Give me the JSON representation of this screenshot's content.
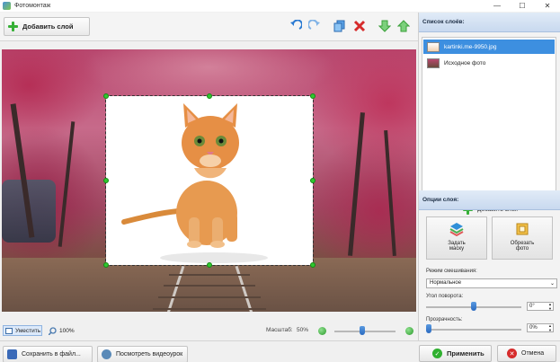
{
  "window": {
    "title": "Фотомонтаж",
    "minimize": "—",
    "maximize": "☐",
    "close": "✕"
  },
  "toolbar": {
    "add_layer_label": "Добавить слой"
  },
  "zoom": {
    "fit_label": "Уместить",
    "actual_size_label": "100%",
    "scale_label": "Масштаб:",
    "scale_value": "50%",
    "level_fraction": 0.45
  },
  "bottom": {
    "save_label": "Сохранить в файл...",
    "video_label": "Посмотреть видеоурок",
    "apply_label": "Применить",
    "cancel_label": "Отмена"
  },
  "layers_panel": {
    "header": "Список слоёв:",
    "layers": [
      {
        "name": "kartinki.me-9950.jpg",
        "selected": true
      },
      {
        "name": "Исходное фото",
        "selected": false
      }
    ],
    "add_label": "Добавить слой"
  },
  "options_panel": {
    "header": "Опции слоя:",
    "mask_label_1": "Задать",
    "mask_label_2": "маску",
    "crop_label_1": "Обрезать",
    "crop_label_2": "фото",
    "blend_label": "Режим смешивания:",
    "blend_value": "Нормальное",
    "rotation_label": "Угол поворота:",
    "rotation_value": "0°",
    "rotation_fraction": 0.5,
    "opacity_label": "Прозрачность:",
    "opacity_value": "0%",
    "opacity_fraction": 0.0
  },
  "colors": {
    "accent_blue": "#3d8fe0",
    "green": "#36b036",
    "red": "#d62b2b"
  }
}
